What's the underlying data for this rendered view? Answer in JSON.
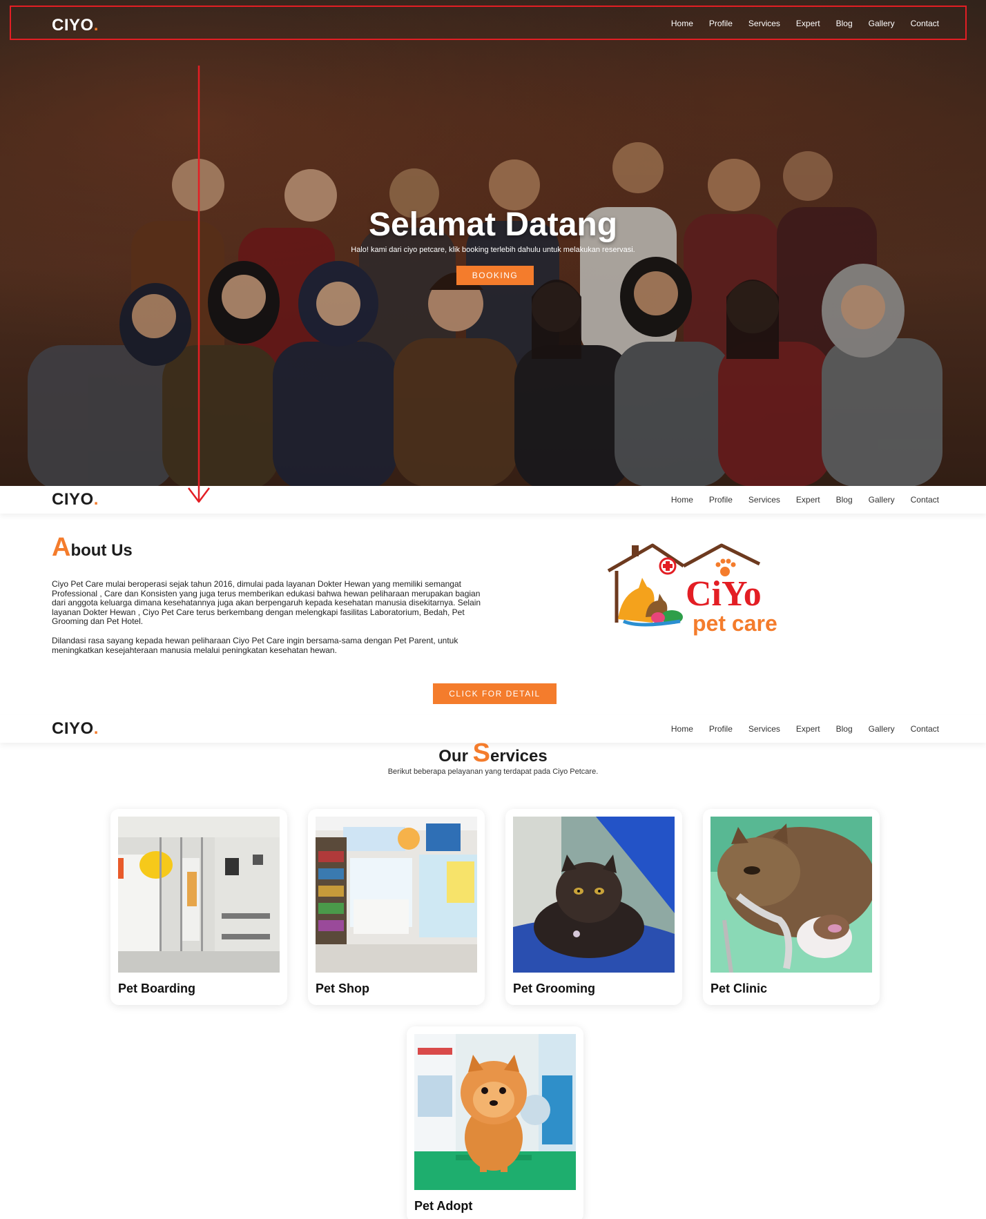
{
  "nav": {
    "brand": "CIYO",
    "brand_dot": ".",
    "items": [
      "Home",
      "Profile",
      "Services",
      "Expert",
      "Blog",
      "Gallery",
      "Contact"
    ]
  },
  "hero": {
    "title": "Selamat Datang",
    "subtitle": "Halo! kami dari ciyo petcare, klik booking terlebih dahulu untuk melakukan reservasi.",
    "button": "BOOKING"
  },
  "about": {
    "title_first": "A",
    "title_rest": "bout Us",
    "paragraph1": "Ciyo Pet Care mulai beroperasi sejak tahun 2016, dimulai pada layanan Dokter Hewan yang memiliki semangat Professional , Care dan Konsisten yang juga terus memberikan edukasi bahwa hewan peliharaan merupakan bagian dari anggota keluarga dimana kesehatannya juga akan berpengaruh kepada kesehatan manusia disekitarnya. Selain layanan Dokter Hewan , Ciyo Pet Care terus berkembang dengan melengkapi fasilitas Laboratorium, Bedah, Pet Grooming dan Pet Hotel.",
    "paragraph2": "Dilandasi rasa sayang kepada hewan peliharaan Ciyo Pet Care ingin bersama-sama dengan Pet Parent, untuk meningkatkan kesejahteraan manusia melalui peningkatan kesehatan hewan.",
    "button": "CLICK FOR DETAIL",
    "logo": {
      "word1": "CiYo",
      "word2": "pet care"
    }
  },
  "services": {
    "title_prefix": "Our ",
    "title_first": "S",
    "title_rest": "ervices",
    "subtitle": "Berikut beberapa pelayanan yang terdapat pada Ciyo Petcare.",
    "cards": [
      {
        "label": "Pet Boarding"
      },
      {
        "label": "Pet Shop"
      },
      {
        "label": "Pet Grooming"
      },
      {
        "label": "Pet Clinic"
      },
      {
        "label": "Pet Adopt"
      }
    ]
  },
  "colors": {
    "accent": "#f47c2c",
    "annotation": "#e31e24"
  }
}
